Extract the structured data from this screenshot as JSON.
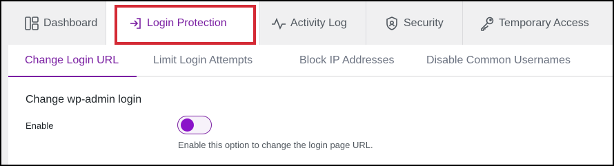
{
  "top_tabs": [
    {
      "label": "Dashboard",
      "icon": "dashboard-icon"
    },
    {
      "label": "Login Protection",
      "icon": "login-arrow-icon"
    },
    {
      "label": "Activity Log",
      "icon": "activity-pulse-icon"
    },
    {
      "label": "Security",
      "icon": "shield-icon"
    },
    {
      "label": "Temporary Access",
      "icon": "key-icon"
    }
  ],
  "sub_tabs": [
    {
      "label": "Change Login URL"
    },
    {
      "label": "Limit Login Attempts"
    },
    {
      "label": "Block IP Addresses"
    },
    {
      "label": "Disable Common Usernames"
    }
  ],
  "section": {
    "title": "Change wp-admin login",
    "enable_label": "Enable",
    "help_text": "Enable this option to change the login page URL."
  },
  "colors": {
    "accent": "#7a1fa2",
    "highlight": "#d42a35"
  },
  "toggle": {
    "state": "on"
  }
}
